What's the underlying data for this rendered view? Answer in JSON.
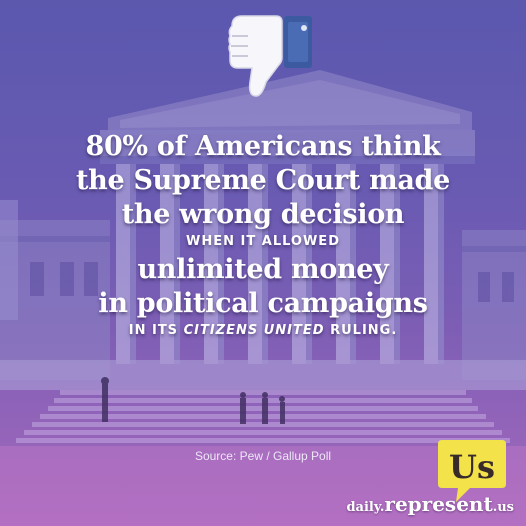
{
  "headline": {
    "line1": "80% of Americans think",
    "line2": "the Supreme Court made",
    "line3": "the wrong decision",
    "line4": "WHEN IT ALLOWED",
    "line5": "unlimited money",
    "line6": "in political campaigns",
    "line7_prefix": "IN ITS ",
    "line7_italic": "CITIZENS UNITED",
    "line7_suffix": " RULING."
  },
  "source": "Source: Pew / Gallup Poll",
  "badge": {
    "text": "Us"
  },
  "footer": {
    "prefix": "daily.",
    "middle": "represent",
    "suffix": ".us"
  },
  "icons": {
    "dislike": "thumbs-down-icon"
  },
  "colors": {
    "purple_top": "#5d5cb0",
    "pink_bottom": "#b66bc0",
    "badge_yellow": "#f3e24a",
    "dislike_blue": "#3b5aa0"
  }
}
